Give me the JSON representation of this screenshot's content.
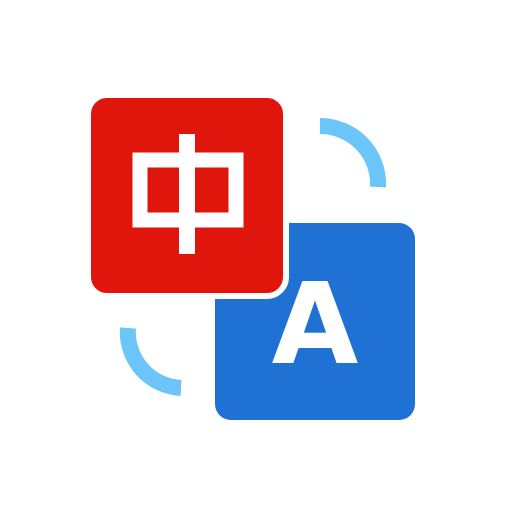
{
  "icon": {
    "name": "translate-app-icon",
    "source_glyph": "中",
    "target_glyph": "A",
    "colors": {
      "source_tile": "#E0150B",
      "target_tile": "#1F72D3",
      "arrow_arcs": "#6BC5F8",
      "glyph": "#FFFFFF",
      "background": "#FFFFFF"
    }
  }
}
